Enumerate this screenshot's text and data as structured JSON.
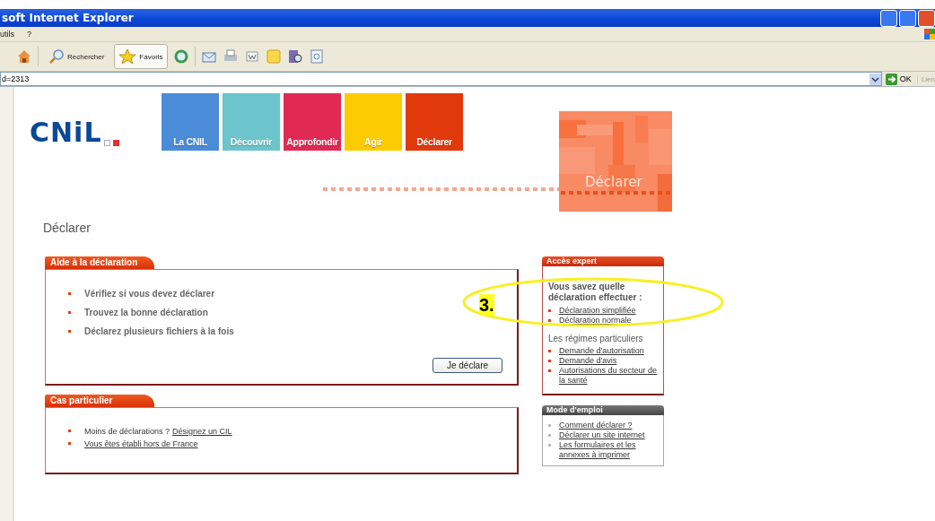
{
  "window": {
    "title": "soft Internet Explorer"
  },
  "menu": [
    "utils",
    "?"
  ],
  "toolbar": [
    {
      "label": "Rechercher",
      "selected": false
    },
    {
      "label": "Favoris",
      "selected": true
    }
  ],
  "address": {
    "value": "d=2313",
    "go": "OK",
    "links": "Lien"
  },
  "logo": "CNiL",
  "nav": [
    {
      "label": "La CNIL",
      "color": "#4a8cd8"
    },
    {
      "label": "Découvrir",
      "color": "#6cc4cc"
    },
    {
      "label": "Approfondir",
      "color": "#e02a54"
    },
    {
      "label": "Agir",
      "color": "#fccc00"
    },
    {
      "label": "Déclarer",
      "color": "#e03a0c"
    }
  ],
  "banner": {
    "label": "Déclarer"
  },
  "heading": "Déclarer",
  "help": {
    "title": "Aide à la déclaration",
    "items": [
      "Vérifiez si vous devez déclarer",
      "Trouvez la bonne déclaration",
      "Déclarez plusieurs fichiers à la fois"
    ],
    "button": "Je déclare"
  },
  "special": {
    "title": "Cas particulier",
    "items": [
      {
        "text": "Moins de déclarations ?",
        "link": "Désignez un CIL"
      },
      {
        "link": "Vous êtes établi hors de France"
      }
    ]
  },
  "expert": {
    "title": "Accès expert",
    "intro": "Vous savez quelle déclaration effectuer :",
    "links": [
      "Déclaration simplifiée",
      "Déclaration normale"
    ],
    "subheading": "Les régimes particuliers",
    "sublinks": [
      "Demande d'autorisation",
      "Demande d'avis",
      "Autorisations du secteur de la santé"
    ]
  },
  "guide": {
    "title": "Mode d'emploi",
    "links": [
      "Comment déclarer ?",
      "Déclarer un site internet",
      "Les formulaires et les annexes à imprimer"
    ]
  },
  "annotation": {
    "label": "3."
  }
}
